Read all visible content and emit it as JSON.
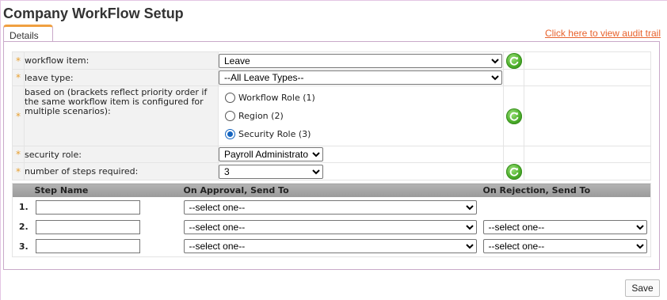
{
  "page": {
    "title": "Company WorkFlow Setup",
    "tab_label": "Details",
    "audit_link": "Click here to view audit trail",
    "save_label": "Save"
  },
  "form": {
    "required_mark": "*",
    "workflow_item": {
      "label": "workflow item:",
      "value": "Leave"
    },
    "leave_type": {
      "label": "leave type:",
      "value": "--All Leave Types--"
    },
    "based_on": {
      "label": "based on (brackets reflect priority order if the same workflow item is configured for multiple scenarios):",
      "options": [
        {
          "label": "Workflow Role (1)",
          "selected": false
        },
        {
          "label": "Region (2)",
          "selected": false
        },
        {
          "label": "Security Role (3)",
          "selected": true
        }
      ]
    },
    "security_role": {
      "label": "security role:",
      "value": "Payroll Administrator"
    },
    "steps_required": {
      "label": "number of steps required:",
      "value": "3"
    }
  },
  "steps": {
    "headers": {
      "step_name": "Step Name",
      "on_approval": "On Approval, Send To",
      "on_rejection": "On Rejection, Send To"
    },
    "rows": [
      {
        "num": "1.",
        "name": "",
        "approval": "--select one--",
        "rejection": null
      },
      {
        "num": "2.",
        "name": "",
        "approval": "--select one--",
        "rejection": "--select one--"
      },
      {
        "num": "3.",
        "name": "",
        "approval": "--select one--",
        "rejection": "--select one--"
      }
    ]
  },
  "icons": {
    "refresh": "refresh-icon"
  },
  "colors": {
    "accent_orange": "#e8622c",
    "required": "#e8a030",
    "refresh_green": "#4caf2a",
    "header_gray": "#a6a6a6"
  }
}
